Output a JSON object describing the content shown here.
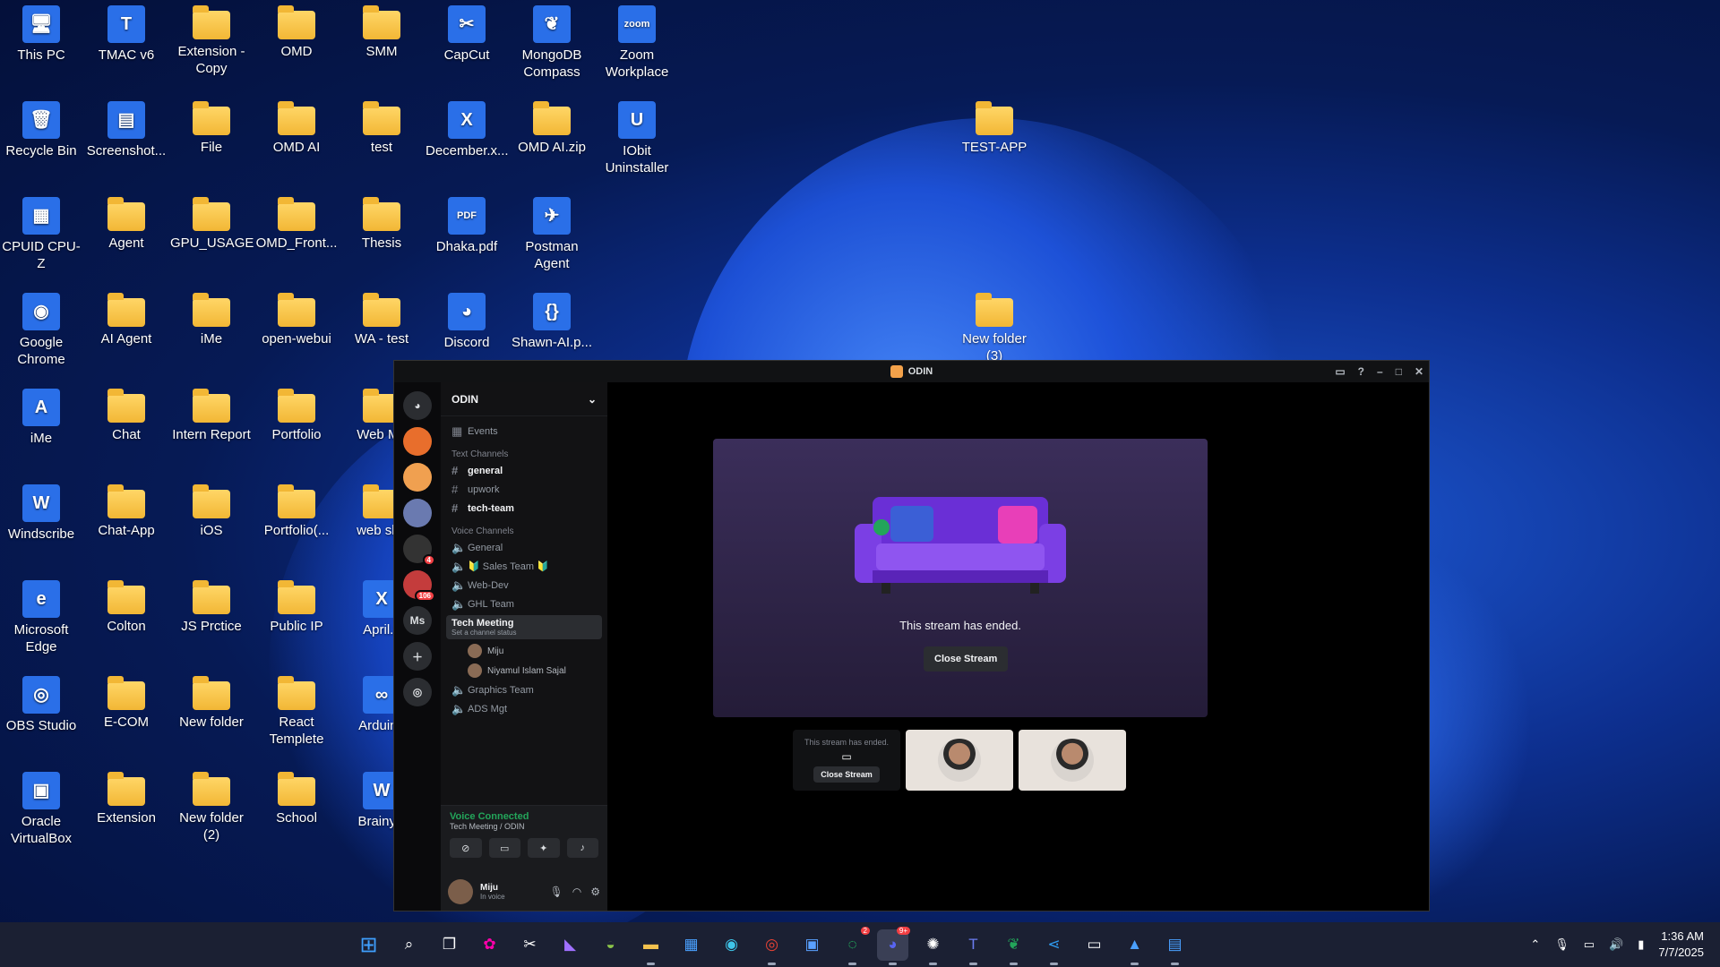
{
  "desktop": {
    "icons": [
      {
        "label": "This PC",
        "glyph": "🖥"
      },
      {
        "label": "TMAC v6",
        "glyph": "T"
      },
      {
        "label": "Extension - Copy",
        "glyph": ""
      },
      {
        "label": "OMD",
        "glyph": ""
      },
      {
        "label": "SMM",
        "glyph": ""
      },
      {
        "label": "CapCut",
        "glyph": "✂"
      },
      {
        "label": "MongoDB Compass",
        "glyph": "❦"
      },
      {
        "label": "Zoom Workplace",
        "glyph": "zoom"
      },
      {
        "label": "Recycle Bin",
        "glyph": "🗑"
      },
      {
        "label": "Screenshot...",
        "glyph": "▤"
      },
      {
        "label": "File",
        "glyph": ""
      },
      {
        "label": "OMD AI",
        "glyph": ""
      },
      {
        "label": "test",
        "glyph": ""
      },
      {
        "label": "December.x...",
        "glyph": "X"
      },
      {
        "label": "OMD AI.zip",
        "glyph": ""
      },
      {
        "label": "IObit Uninstaller",
        "glyph": "U"
      },
      {
        "label": "TEST-APP",
        "glyph": ""
      },
      {
        "label": "CPUID CPU-Z",
        "glyph": "▦"
      },
      {
        "label": "Agent",
        "glyph": ""
      },
      {
        "label": "GPU_USAGE",
        "glyph": ""
      },
      {
        "label": "OMD_Front...",
        "glyph": ""
      },
      {
        "label": "Thesis",
        "glyph": ""
      },
      {
        "label": "Dhaka.pdf",
        "glyph": "PDF"
      },
      {
        "label": "Postman Agent",
        "glyph": "✈"
      },
      {
        "label": "Google Chrome",
        "glyph": "◉"
      },
      {
        "label": "AI Agent",
        "glyph": ""
      },
      {
        "label": "iMe",
        "glyph": ""
      },
      {
        "label": "open-webui",
        "glyph": ""
      },
      {
        "label": "WA - test",
        "glyph": ""
      },
      {
        "label": "Discord",
        "glyph": "◕"
      },
      {
        "label": "Shawn-AI.p...",
        "glyph": "{}"
      },
      {
        "label": "New folder (3)",
        "glyph": ""
      },
      {
        "label": "iMe",
        "glyph": "A"
      },
      {
        "label": "Chat",
        "glyph": ""
      },
      {
        "label": "Intern Report",
        "glyph": ""
      },
      {
        "label": "Portfolio",
        "glyph": ""
      },
      {
        "label": "Web Mo",
        "glyph": ""
      },
      {
        "label": "Windscribe",
        "glyph": "W"
      },
      {
        "label": "Chat-App",
        "glyph": ""
      },
      {
        "label": "iOS",
        "glyph": ""
      },
      {
        "label": "Portfolio(...",
        "glyph": ""
      },
      {
        "label": "web sho",
        "glyph": ""
      },
      {
        "label": "Microsoft Edge",
        "glyph": "e"
      },
      {
        "label": "Colton",
        "glyph": ""
      },
      {
        "label": "JS Prctice",
        "glyph": ""
      },
      {
        "label": "Public IP",
        "glyph": ""
      },
      {
        "label": "April.x",
        "glyph": "X"
      },
      {
        "label": "OBS Studio",
        "glyph": "◎"
      },
      {
        "label": "E-COM",
        "glyph": ""
      },
      {
        "label": "New folder",
        "glyph": ""
      },
      {
        "label": "React Templete",
        "glyph": ""
      },
      {
        "label": "Arduino",
        "glyph": "∞"
      },
      {
        "label": "Oracle VirtualBox",
        "glyph": "▣"
      },
      {
        "label": "Extension",
        "glyph": ""
      },
      {
        "label": "New folder (2)",
        "glyph": ""
      },
      {
        "label": "School",
        "glyph": ""
      },
      {
        "label": "Brainy.c",
        "glyph": "W"
      }
    ]
  },
  "discord": {
    "title": "ODIN",
    "server_name": "ODIN",
    "events_label": "Events",
    "text_channels_label": "Text Channels",
    "text_channels": [
      "general",
      "upwork",
      "tech-team"
    ],
    "voice_channels_label": "Voice Channels",
    "voice_channels": [
      "General",
      "🔰 Sales Team 🔰",
      "Web-Dev",
      "GHL Team"
    ],
    "active_voice": {
      "name": "Tech Meeting",
      "status": "Set a channel status"
    },
    "members": [
      "Miju",
      "Niyamul Islam Sajal"
    ],
    "voice_channels_after": [
      "Graphics Team",
      "ADS Mgt"
    ],
    "server_badges": {
      "one": "4",
      "two": "106"
    },
    "server_ms": "Ms",
    "voice_panel": {
      "status": "Voice Connected",
      "location": "Tech Meeting / ODIN"
    },
    "user": {
      "name": "Miju",
      "status": "In voice"
    },
    "stream_ended": "This stream has ended.",
    "close_stream": "Close Stream",
    "thumb_ended": "This stream has ended.",
    "thumb_close": "Close Stream"
  },
  "taskbar": {
    "discord_badge": "9+",
    "whatsapp_badge": "2",
    "time": "1:36 AM",
    "date": "7/7/2025"
  }
}
